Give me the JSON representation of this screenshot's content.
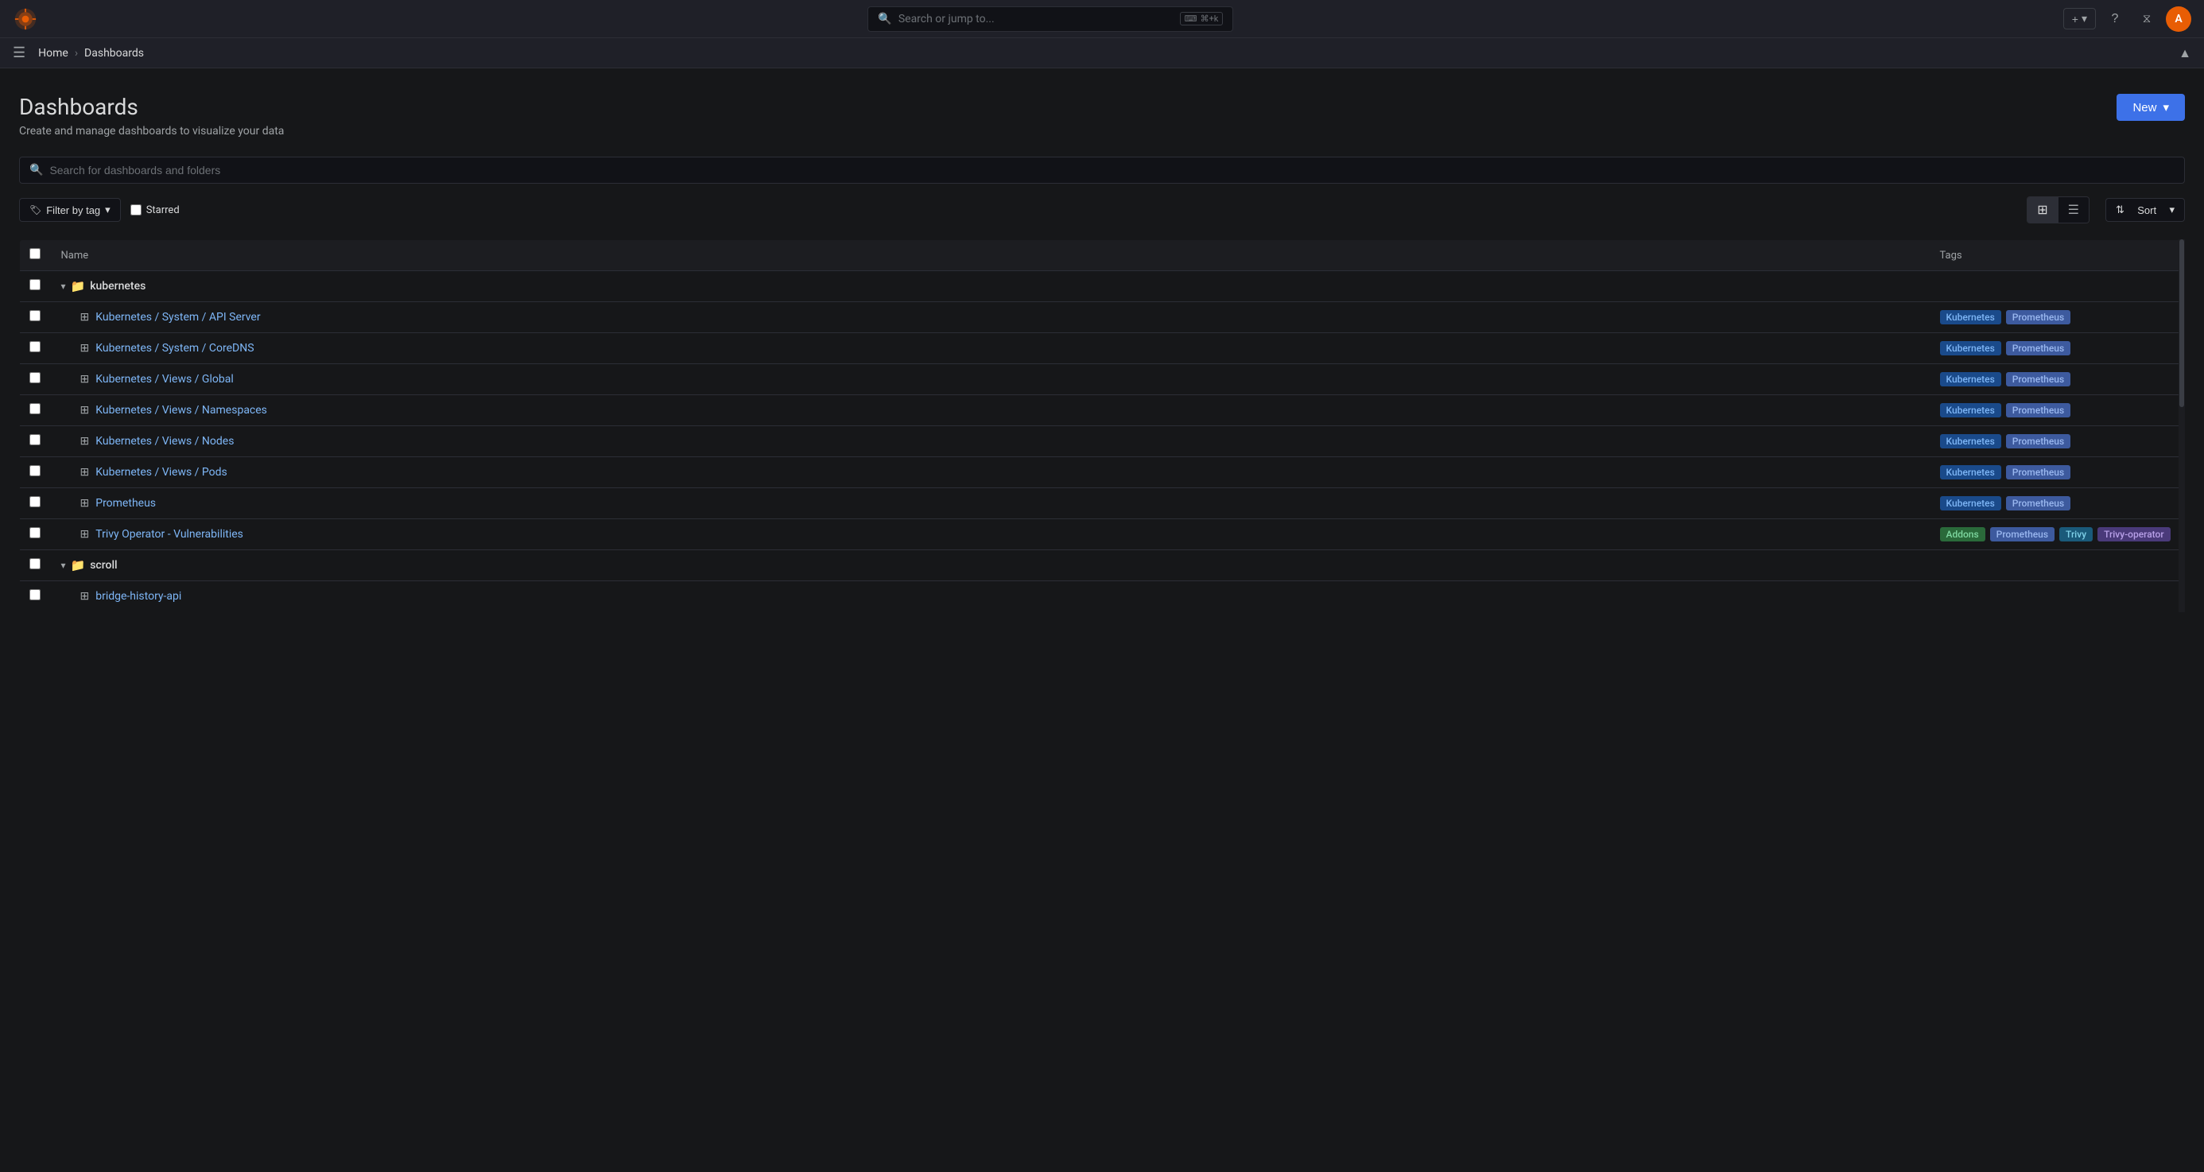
{
  "app": {
    "logo_text": "🔥",
    "logo_color": "#e85d04"
  },
  "topnav": {
    "search_placeholder": "Search or jump to...",
    "shortcut_icon": "⌨",
    "shortcut_keys": "⌘+k",
    "new_icon": "+",
    "new_chevron": "▾",
    "help_icon": "?",
    "rss_icon": "≡",
    "avatar_initial": "A"
  },
  "breadcrumb": {
    "home": "Home",
    "separator": "›",
    "current": "Dashboards"
  },
  "page": {
    "title": "Dashboards",
    "subtitle": "Create and manage dashboards to visualize your data",
    "new_button": "New",
    "new_button_chevron": "▾",
    "search_placeholder": "Search for dashboards and folders",
    "filter_by_tag": "Filter by tag",
    "starred_label": "Starred",
    "sort_label": "Sort",
    "sort_chevron": "▾"
  },
  "table": {
    "col_name": "Name",
    "col_tags": "Tags",
    "folders": [
      {
        "id": "kubernetes",
        "name": "kubernetes",
        "expanded": true,
        "items": [
          {
            "name": "Kubernetes / System / API Server",
            "tags": [
              {
                "label": "Kubernetes",
                "type": "kubernetes"
              },
              {
                "label": "Prometheus",
                "type": "prometheus"
              }
            ]
          },
          {
            "name": "Kubernetes / System / CoreDNS",
            "tags": [
              {
                "label": "Kubernetes",
                "type": "kubernetes"
              },
              {
                "label": "Prometheus",
                "type": "prometheus"
              }
            ]
          },
          {
            "name": "Kubernetes / Views / Global",
            "tags": [
              {
                "label": "Kubernetes",
                "type": "kubernetes"
              },
              {
                "label": "Prometheus",
                "type": "prometheus"
              }
            ]
          },
          {
            "name": "Kubernetes / Views / Namespaces",
            "tags": [
              {
                "label": "Kubernetes",
                "type": "kubernetes"
              },
              {
                "label": "Prometheus",
                "type": "prometheus"
              }
            ]
          },
          {
            "name": "Kubernetes / Views / Nodes",
            "tags": [
              {
                "label": "Kubernetes",
                "type": "kubernetes"
              },
              {
                "label": "Prometheus",
                "type": "prometheus"
              }
            ]
          },
          {
            "name": "Kubernetes / Views / Pods",
            "tags": [
              {
                "label": "Kubernetes",
                "type": "kubernetes"
              },
              {
                "label": "Prometheus",
                "type": "prometheus"
              }
            ]
          },
          {
            "name": "Prometheus",
            "tags": [
              {
                "label": "Kubernetes",
                "type": "kubernetes"
              },
              {
                "label": "Prometheus",
                "type": "prometheus"
              }
            ]
          },
          {
            "name": "Trivy Operator - Vulnerabilities",
            "tags": [
              {
                "label": "Addons",
                "type": "addons"
              },
              {
                "label": "Prometheus",
                "type": "prometheus"
              },
              {
                "label": "Trivy",
                "type": "trivy"
              },
              {
                "label": "Trivy-operator",
                "type": "trivy-operator"
              }
            ]
          }
        ]
      },
      {
        "id": "scroll",
        "name": "scroll",
        "expanded": true,
        "items": [
          {
            "name": "bridge-history-api",
            "tags": []
          }
        ]
      }
    ]
  }
}
